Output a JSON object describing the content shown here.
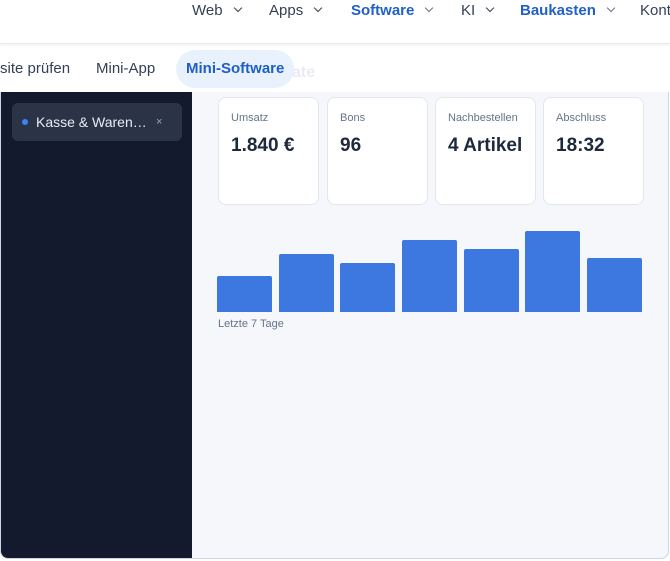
{
  "nav": {
    "items": [
      {
        "label": "Web",
        "active": false
      },
      {
        "label": "Apps",
        "active": false
      },
      {
        "label": "Software",
        "active": true
      },
      {
        "label": "KI",
        "active": false
      },
      {
        "label": "Baukasten",
        "active": true
      },
      {
        "label": "Kont"
      }
    ]
  },
  "subtabs": [
    {
      "label": "site prüfen",
      "active": false
    },
    {
      "label": "Mini-App",
      "active": false
    },
    {
      "label": "Mini-Software",
      "active": true
    }
  ],
  "ghost_title": "ate",
  "sidebar": {
    "tab_label": "Kasse & Waren…",
    "close": "×"
  },
  "kpis": [
    {
      "label": "Umsatz",
      "value": "1.840 €"
    },
    {
      "label": "Bons",
      "value": "96"
    },
    {
      "label": "Nachbestellen",
      "value": "4 Artikel"
    },
    {
      "label": "Abschluss",
      "value": "18:32"
    }
  ],
  "chart_data": {
    "type": "bar",
    "categories": [],
    "values": [
      36,
      58,
      49,
      72,
      63,
      81,
      54
    ],
    "ylim": [
      0,
      81
    ],
    "caption": "Letzte 7 Tage",
    "color": "#3d77e0"
  },
  "colors": {
    "accent": "#2060c8",
    "sidebar_bg": "#141a2d",
    "bar": "#3d77e0"
  }
}
